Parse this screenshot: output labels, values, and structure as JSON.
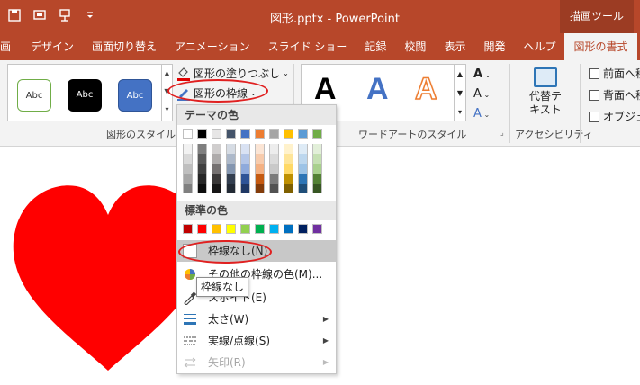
{
  "titlebar": {
    "title": "図形.pptx  -  PowerPoint",
    "context_tab": "描画ツール",
    "qat": [
      "save-icon",
      "slideshow-icon",
      "pin-icon",
      "customize-icon"
    ]
  },
  "tabs": [
    {
      "label": "画"
    },
    {
      "label": "デザイン"
    },
    {
      "label": "画面切り替え"
    },
    {
      "label": "アニメーション"
    },
    {
      "label": "スライド ショー"
    },
    {
      "label": "記録"
    },
    {
      "label": "校閲"
    },
    {
      "label": "表示"
    },
    {
      "label": "開発"
    },
    {
      "label": "ヘルプ"
    },
    {
      "label": "図形の書式"
    }
  ],
  "ribbon": {
    "style_samples": [
      "Abc",
      "Abc",
      "Abc"
    ],
    "shape_fill": "図形の塗りつぶし",
    "shape_outline": "図形の枠線",
    "group_shape_styles": "図形のスタイル",
    "wordart_letters": [
      "A",
      "A",
      "A"
    ],
    "group_wordart": "ワードアートのスタイル",
    "text_fill": "A",
    "text_outline": "A",
    "text_effects": "A",
    "alt_text": "代替テキスト",
    "alt_text_line1": "代替テ",
    "alt_text_line2": "キスト",
    "group_accessibility": "アクセシビリティ",
    "bring_forward": "前面へ移",
    "send_backward": "背面へ移",
    "selection_pane": "オブジェ"
  },
  "dropdown": {
    "theme_colors_header": "テーマの色",
    "standard_colors_header": "標準の色",
    "theme_colors": [
      "#ffffff",
      "#000000",
      "#e7e6e6",
      "#44546a",
      "#4472c4",
      "#ed7d31",
      "#a5a5a5",
      "#ffc000",
      "#5b9bd5",
      "#70ad47"
    ],
    "theme_shades": [
      [
        "#f2f2f2",
        "#d9d9d9",
        "#bfbfbf",
        "#a6a6a6",
        "#808080"
      ],
      [
        "#7f7f7f",
        "#595959",
        "#404040",
        "#262626",
        "#0d0d0d"
      ],
      [
        "#d0cece",
        "#aeabab",
        "#757171",
        "#3a3838",
        "#171616"
      ],
      [
        "#d6dce4",
        "#adb9ca",
        "#8496b0",
        "#333f50",
        "#222a35"
      ],
      [
        "#d9e2f3",
        "#b4c6e7",
        "#8eaadb",
        "#2f5496",
        "#1f3864"
      ],
      [
        "#fbe5d5",
        "#f7cbac",
        "#f4b183",
        "#c55a11",
        "#833c0b"
      ],
      [
        "#ededed",
        "#dbdbdb",
        "#c9c9c9",
        "#7b7b7b",
        "#525252"
      ],
      [
        "#fff2cc",
        "#fee599",
        "#ffd966",
        "#bf9000",
        "#7f6000"
      ],
      [
        "#deebf6",
        "#bdd7ee",
        "#9dc3e6",
        "#2e75b5",
        "#1f4e79"
      ],
      [
        "#e2efd9",
        "#c5e0b3",
        "#a8d08d",
        "#538135",
        "#375623"
      ]
    ],
    "standard_colors": [
      "#c00000",
      "#ff0000",
      "#ffc000",
      "#ffff00",
      "#92d050",
      "#00b050",
      "#00b0f0",
      "#0070c0",
      "#002060",
      "#7030a0"
    ],
    "no_outline": "枠線なし(N)",
    "more_colors": "その他の枠線の色(M)...",
    "eyedropper": "スポイト(E)",
    "weight": "太さ(W)",
    "dashes": "実線/点線(S)",
    "arrows": "矢印(R)"
  },
  "tooltip": {
    "text": "枠線なし"
  },
  "colors": {
    "accent": "#b7472a",
    "heart": "#ff0000",
    "annotation": "#e02020"
  }
}
